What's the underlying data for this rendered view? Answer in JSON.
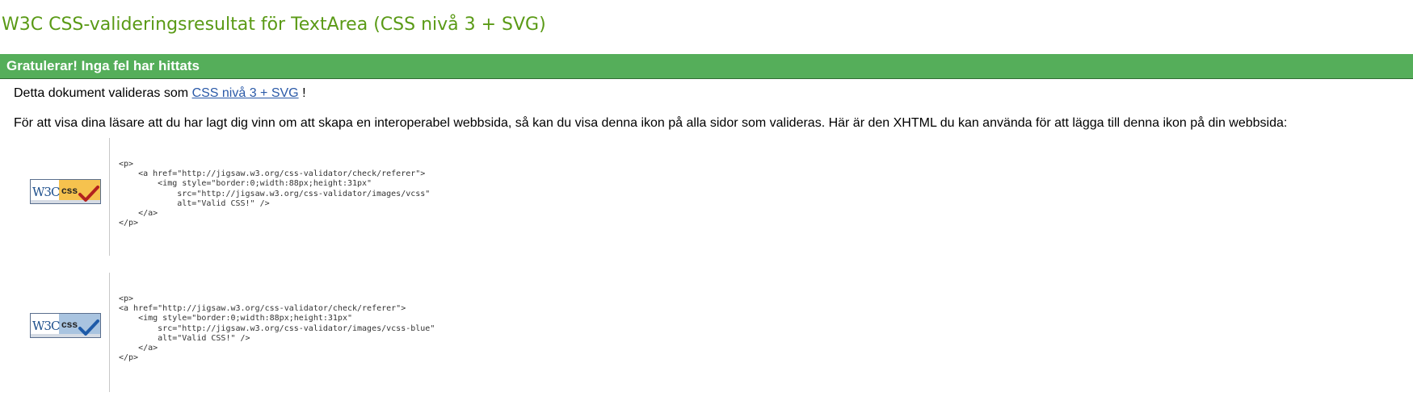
{
  "page": {
    "title": "W3C CSS-valideringsresultat för TextArea (CSS nivå 3 + SVG)"
  },
  "congrats": {
    "title": "Gratulerar! Inga fel har hittats"
  },
  "validity": {
    "prefix": "Detta dokument valideras som",
    "link_label": "CSS nivå 3 + SVG",
    "suffix": "!"
  },
  "intro": {
    "text": "För att visa dina läsare att du har lagt dig vinn om att skapa en interoperabel webbsida, så kan du visa denna ikon på alla sidor som valideras. Här är den XHTML du kan använda för att lägga till denna ikon på din webbsida:"
  },
  "badges": [
    {
      "w3c_text": "W3C",
      "css_text": "css",
      "color_primary": "#f6c24e",
      "check_color": "#b3211e",
      "icon": "valid-css-badge-yellow",
      "code": "<p>\n    <a href=\"http://jigsaw.w3.org/css-validator/check/referer\">\n        <img style=\"border:0;width:88px;height:31px\"\n            src=\"http://jigsaw.w3.org/css-validator/images/vcss\"\n            alt=\"Valid CSS!\" />\n    </a>\n</p>"
    },
    {
      "w3c_text": "W3C",
      "css_text": "css",
      "color_primary": "#a9c4e0",
      "check_color": "#1d5aa8",
      "icon": "valid-css-badge-blue",
      "code": "<p>\n<a href=\"http://jigsaw.w3.org/css-validator/check/referer\">\n    <img style=\"border:0;width:88px;height:31px\"\n        src=\"http://jigsaw.w3.org/css-validator/images/vcss-blue\"\n        alt=\"Valid CSS!\" />\n    </a>\n</p>"
    }
  ]
}
